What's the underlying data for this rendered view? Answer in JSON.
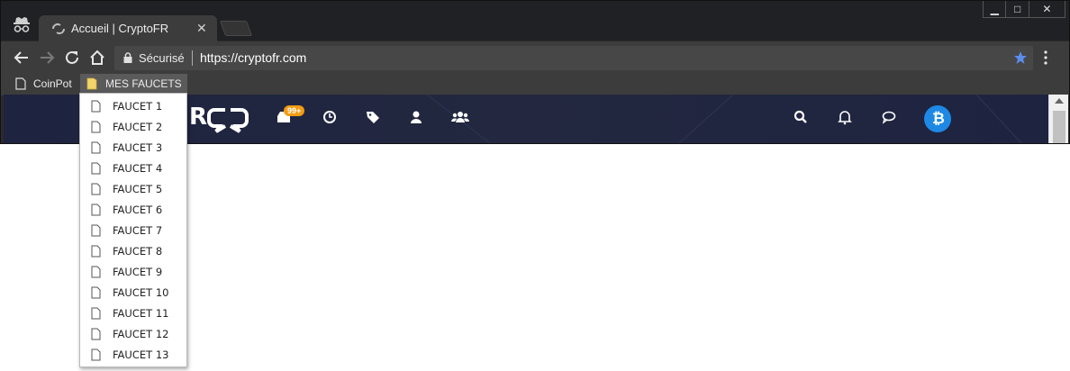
{
  "browser": {
    "tab": {
      "title": "Accueil | CryptoFR",
      "close_glyph": "✕",
      "favicon": "cryptofr-logo-icon"
    },
    "window_controls": {
      "minimize": "▁",
      "maximize": "□",
      "close": "✕"
    },
    "omnibox": {
      "security_label": "Sécurisé",
      "url": "https://cryptofr.com"
    },
    "bookmarks": [
      {
        "label": "CoinPot",
        "icon": "page-icon"
      },
      {
        "label": "MES FAUCETS",
        "icon": "folder-icon"
      }
    ],
    "bookmark_folder_menu": [
      "FAUCET 1",
      "FAUCET 2",
      "FAUCET 3",
      "FAUCET 4",
      "FAUCET 5",
      "FAUCET 6",
      "FAUCET 7",
      "FAUCET 8",
      "FAUCET 9",
      "FAUCET 10",
      "FAUCET 11",
      "FAUCET 12",
      "FAUCET 13"
    ]
  },
  "site": {
    "logo_letter": "R",
    "notification_badge": "99+",
    "bitcoin_glyph": "₿",
    "nav_icons": [
      "inbox-icon",
      "clock-icon",
      "tags-icon",
      "user-icon",
      "users-icon",
      "search-icon",
      "bell-icon",
      "chat-icon",
      "bitcoin-icon"
    ]
  },
  "colors": {
    "accent_star": "#5b8def",
    "badge": "#f39c12",
    "bitcoin": "#1e88e5",
    "site_header": "#1e2340"
  }
}
